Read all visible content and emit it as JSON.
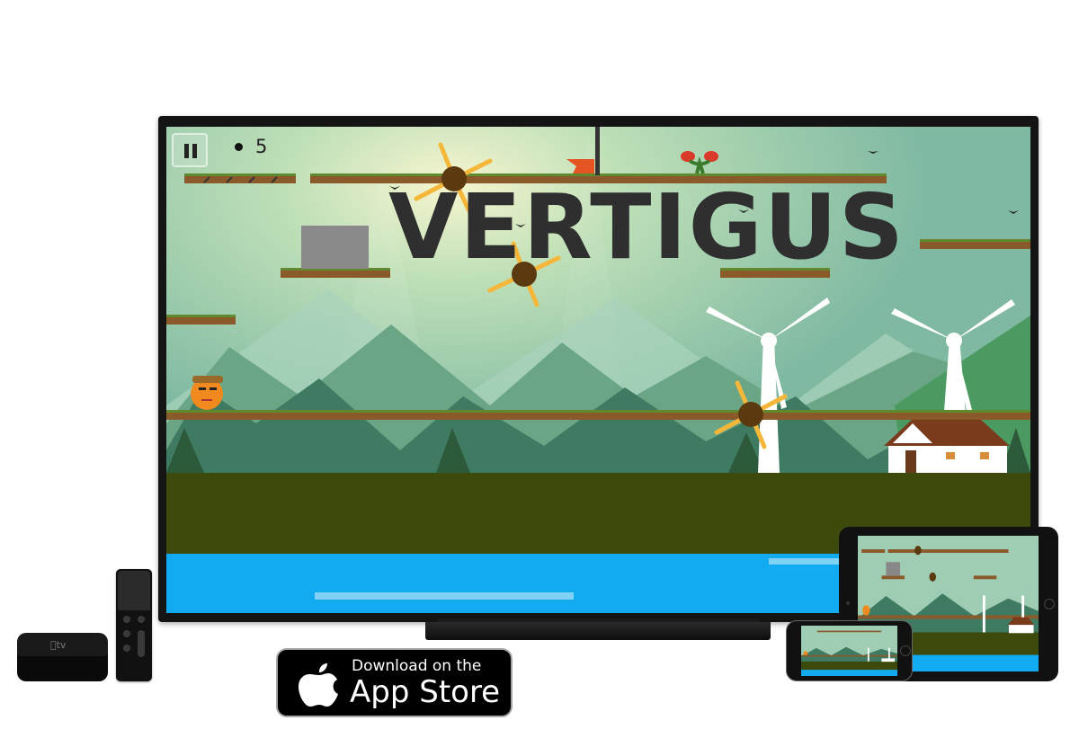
{
  "game": {
    "title": "VERTIGUS",
    "score": "5",
    "pause_label": "Pause"
  },
  "badge": {
    "line1": "Download on the",
    "line2": "App Store"
  },
  "devices": {
    "apple_tv_logo": "tv"
  },
  "colors": {
    "sky": "#9fd0b5",
    "sun_glow": "#f4f2c8",
    "mountain_far": "#6aa586",
    "mountain_near": "#3f7a62",
    "ground": "#3c4a0b",
    "water": "#12aaf0",
    "platform_dirt": "#8b5a2b",
    "platform_grass": "#5f8a2f",
    "title_text": "#2f2f2f",
    "spike_ball": "#5b3a10",
    "spark": "#f5b73a"
  }
}
